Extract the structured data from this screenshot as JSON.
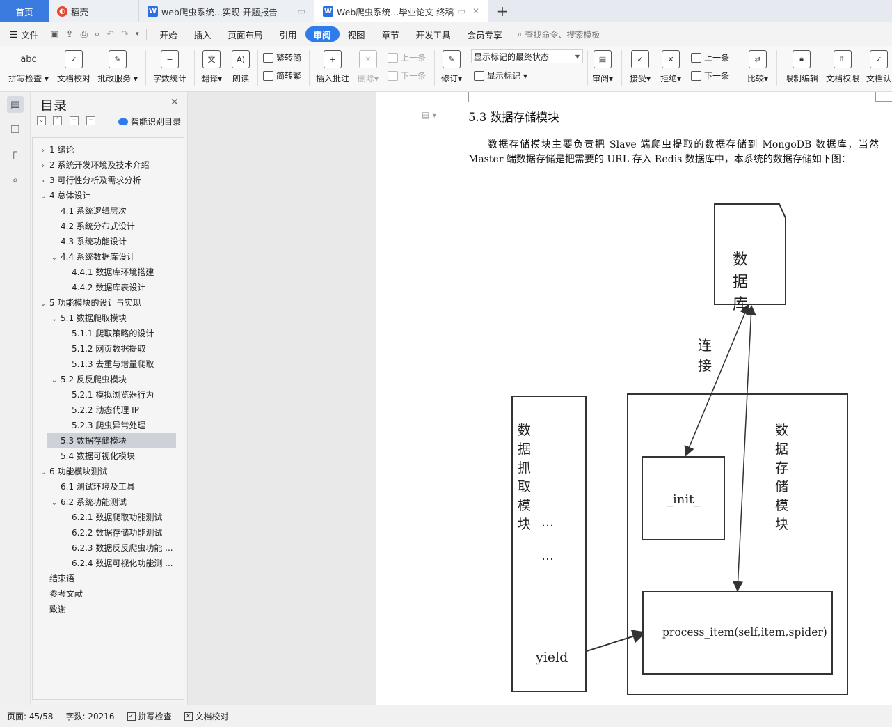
{
  "tabs": [
    {
      "label": "首页"
    },
    {
      "label": "稻壳"
    },
    {
      "label": "web爬虫系统...实现 开题报告"
    },
    {
      "label": "Web爬虫系统...毕业论文 终稿"
    }
  ],
  "menu": {
    "file": "文件",
    "items": [
      "开始",
      "插入",
      "页面布局",
      "引用",
      "审阅",
      "视图",
      "章节",
      "开发工具",
      "会员专享"
    ],
    "active": "审阅",
    "search": "查找命令、搜索模板"
  },
  "ribbon": {
    "spell_icon": "abc",
    "spell": "拼写检查",
    "proofread": "文档校对",
    "batch": "批改服务",
    "wordcount": "字数统计",
    "translate": "翻译",
    "read": "朗读",
    "trad_to_simp": "繁转简",
    "simp_to_trad": "简转繁",
    "insert_comment": "插入批注",
    "delete": "删除",
    "prev1": "上一条",
    "next1": "下一条",
    "revise": "修订",
    "markup_state": "显示标记的最终状态",
    "show_markup": "显示标记",
    "review": "审阅",
    "accept": "接受",
    "reject": "拒绝",
    "prev2": "上一条",
    "next2": "下一条",
    "compare": "比较",
    "restrict": "限制编辑",
    "permission": "文档权限",
    "doc_auth": "文档认"
  },
  "toc": {
    "title": "目录",
    "smart": "智能识别目录",
    "items": [
      {
        "text": "1  绪论",
        "chev": "›"
      },
      {
        "text": "2  系统开发环境及技术介绍",
        "chev": "›"
      },
      {
        "text": "3  可行性分析及需求分析",
        "chev": "›"
      },
      {
        "text": "4  总体设计",
        "chev": "⌄"
      },
      {
        "text": "4.1  系统逻辑层次",
        "chev": ""
      },
      {
        "text": "4.2  系统分布式设计",
        "chev": ""
      },
      {
        "text": "4.3  系统功能设计",
        "chev": ""
      },
      {
        "text": "4.4  系统数据库设计",
        "chev": "⌄"
      },
      {
        "text": "4.4.1  数据库环境搭建",
        "chev": ""
      },
      {
        "text": "4.4.2  数据库表设计",
        "chev": ""
      },
      {
        "text": "5  功能模块的设计与实现",
        "chev": "⌄"
      },
      {
        "text": "5.1  数据爬取模块",
        "chev": "⌄"
      },
      {
        "text": "5.1.1  爬取策略的设计",
        "chev": ""
      },
      {
        "text": "5.1.2  网页数据提取",
        "chev": ""
      },
      {
        "text": "5.1.3  去重与增量爬取",
        "chev": ""
      },
      {
        "text": "5.2  反反爬虫模块",
        "chev": "⌄"
      },
      {
        "text": "5.2.1  模拟浏览器行为",
        "chev": ""
      },
      {
        "text": "5.2.2  动态代理 IP",
        "chev": ""
      },
      {
        "text": "5.2.3  爬虫异常处理",
        "chev": ""
      },
      {
        "text": "5.3  数据存储模块",
        "chev": ""
      },
      {
        "text": "5.4  数据可视化模块",
        "chev": ""
      },
      {
        "text": "6  功能模块测试",
        "chev": "⌄"
      },
      {
        "text": "6.1  测试环境及工具",
        "chev": ""
      },
      {
        "text": "6.2  系统功能测试",
        "chev": "⌄"
      },
      {
        "text": "6.2.1  数据爬取功能测试",
        "chev": ""
      },
      {
        "text": "6.2.2  数据存储功能测试",
        "chev": ""
      },
      {
        "text": "6.2.3  数据反反爬虫功能 ...",
        "chev": ""
      },
      {
        "text": "6.2.4  数据可视化功能测 ...",
        "chev": ""
      },
      {
        "text": "结束语",
        "chev": ""
      },
      {
        "text": "参考文献",
        "chev": ""
      },
      {
        "text": "致谢",
        "chev": ""
      }
    ]
  },
  "doc": {
    "heading": "5.3  数据存储模块",
    "paragraph": "数据存储模块主要负责把 Slave 端爬虫提取的数据存储到 MongoDB 数据库，当然 Master 端数据存储是把需要的 URL 存入 Redis 数据库中，本系统的数据存储如下图："
  },
  "figure": {
    "database": "数据库",
    "connect": "连接",
    "fetch_module": "数据抓取模块",
    "dots1": "…",
    "dots2": "…",
    "yield": "yield",
    "storage_module": "数据存储模块",
    "init": "_init_",
    "process_item": "process_item(self,item,spider)"
  },
  "status": {
    "page": "页面: 45/58",
    "words": "字数: 20216",
    "spell": "拼写检查",
    "proof": "文档校对"
  },
  "colors": {
    "accent": "#2f7bea",
    "home_tab": "#3a7be0",
    "toc_selected": "#cdd1d8"
  }
}
